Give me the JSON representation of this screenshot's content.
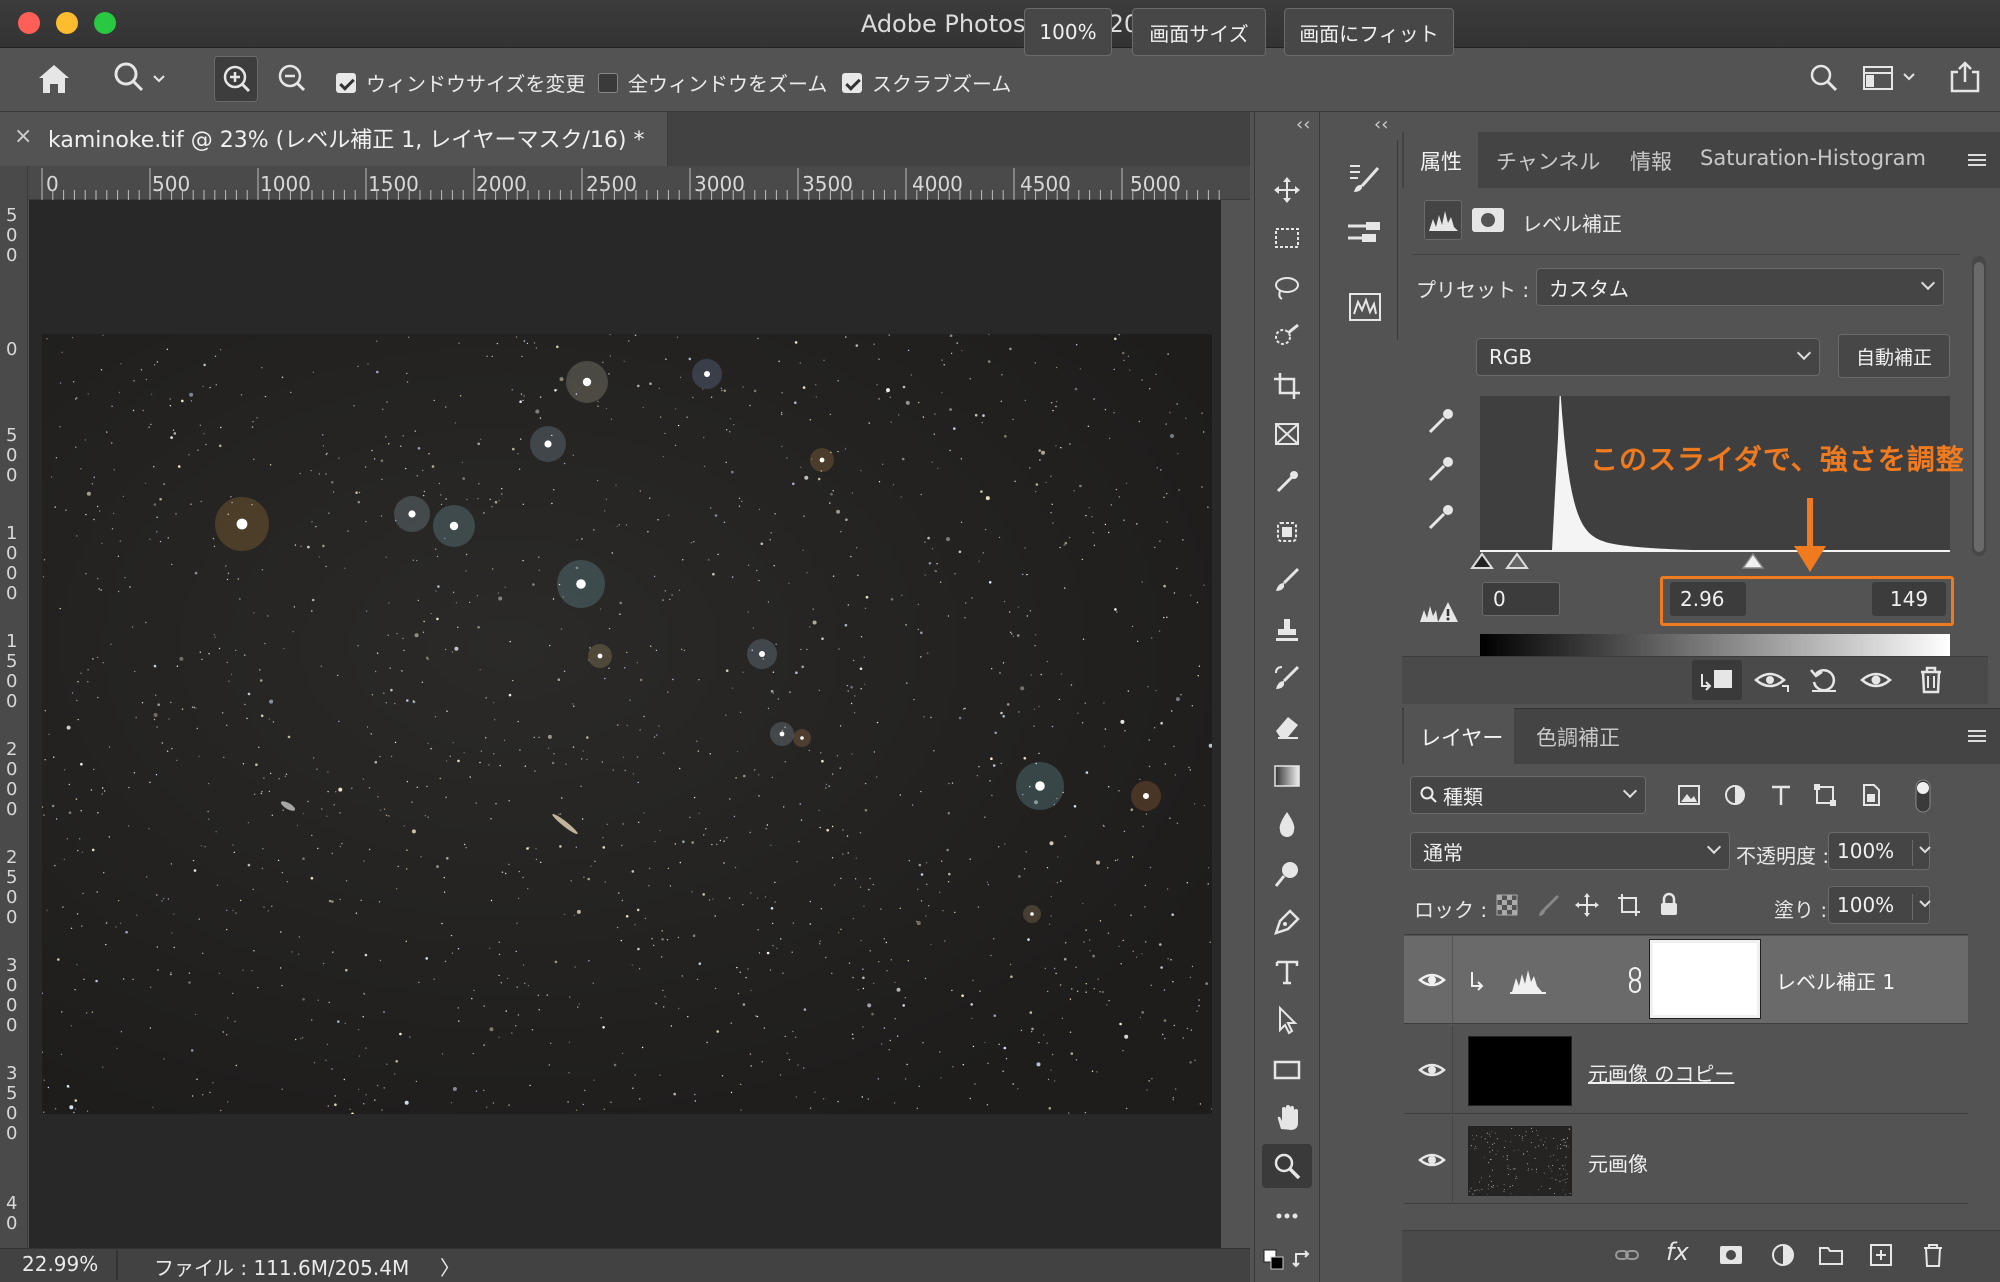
{
  "window": {
    "title": "Adobe Photoshop 2020"
  },
  "options_bar": {
    "resize_windows_label": "ウィンドウサイズを変更",
    "zoom_all_label": "全ウィンドウをズーム",
    "scrubby_zoom_label": "スクラブズーム",
    "zoom_value": "100%",
    "screen_size_label": "画面サイズ",
    "fit_screen_label": "画面にフィット"
  },
  "document": {
    "tab_title": "kaminoke.tif @ 23% (レベル補正 1, レイヤーマスク/16) *",
    "close_glyph": "×"
  },
  "ruler": {
    "h_ticks": [
      "0",
      "500",
      "1000",
      "1500",
      "2000",
      "2500",
      "3000",
      "3500",
      "4000",
      "4500",
      "5000"
    ],
    "v_ticks": [
      "5\n0\n0",
      "0",
      "5\n0\n0",
      "1\n0\n0\n0",
      "1\n5\n0\n0",
      "2\n0\n0\n0",
      "2\n5\n0\n0",
      "3\n0\n0\n0",
      "3\n5\n0\n0",
      "4\n0"
    ]
  },
  "status": {
    "zoom": "22.99%",
    "file_info": "ファイル : 111.6M/205.4M",
    "arrow": "〉"
  },
  "panels": {
    "collapse_left": "‹‹",
    "collapse_mid": "‹‹",
    "expand_right": "››",
    "properties_tabs": [
      "属性",
      "チャンネル",
      "情報",
      "Saturation-Histogram"
    ],
    "adjustment_name": "レベル補正",
    "preset_label": "プリセット :",
    "preset_value": "カスタム",
    "channel_value": "RGB",
    "auto_button": "自動補正",
    "annotation_text": "このスライダで、強さを調整",
    "input_black": "0",
    "input_gamma": "2.96",
    "input_white": "149",
    "layers_tabs": [
      "レイヤー",
      "色調補正"
    ],
    "filter_kind": "種類",
    "blend_mode": "通常",
    "opacity_label": "不透明度 :",
    "opacity_value": "100%",
    "lock_label": "ロック :",
    "fill_label": "塗り :",
    "fill_value": "100%",
    "layers": [
      {
        "name": "レベル補正 1",
        "type": "adjustment"
      },
      {
        "name": "元画像 のコピー",
        "type": "black"
      },
      {
        "name": "元画像",
        "type": "image"
      }
    ],
    "footer_fx": "fx"
  },
  "colors": {
    "annotation": "#f07a1e",
    "close": "#ff5f57",
    "minimize": "#febc2e",
    "maximize": "#28c840"
  },
  "histogram": {
    "peak_position": 0.17,
    "gamma_slider_position": 0.58
  }
}
